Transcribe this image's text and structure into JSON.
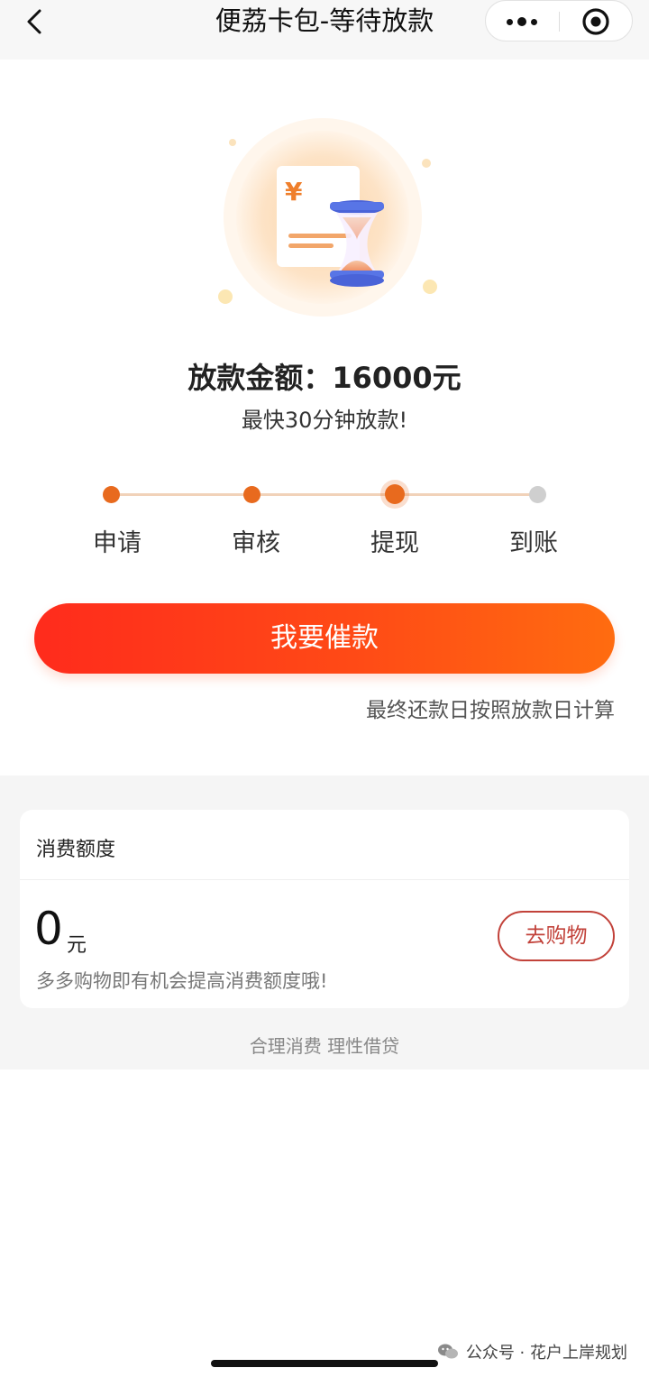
{
  "header": {
    "title": "便荔卡包-等待放款"
  },
  "loan": {
    "amount_line": "放款金额：16000元",
    "speed_line": "最快30分钟放款!"
  },
  "progress": {
    "steps": [
      "申请",
      "审核",
      "提现",
      "到账"
    ],
    "current_index": 2
  },
  "actions": {
    "urge_label": "我要催款",
    "repay_note": "最终还款日按照放款日计算"
  },
  "quota": {
    "title": "消费额度",
    "value": "0",
    "unit": "元",
    "hint": "多多购物即有机会提高消费额度哦!",
    "shop_label": "去购物"
  },
  "footer": {
    "slogan": "合理消费 理性借贷",
    "watermark": "公众号 · 花户上岸规划"
  },
  "icons": {
    "back": "chevron-left-icon",
    "more": "more-dots-icon",
    "close": "target-circle-icon",
    "illustration": "bill-hourglass-icon",
    "wechat": "wechat-icon"
  },
  "colors": {
    "accent": "#e86a1e",
    "button_start": "#ff2b1c",
    "button_end": "#ff6c10",
    "shop_border": "#c2423a"
  }
}
